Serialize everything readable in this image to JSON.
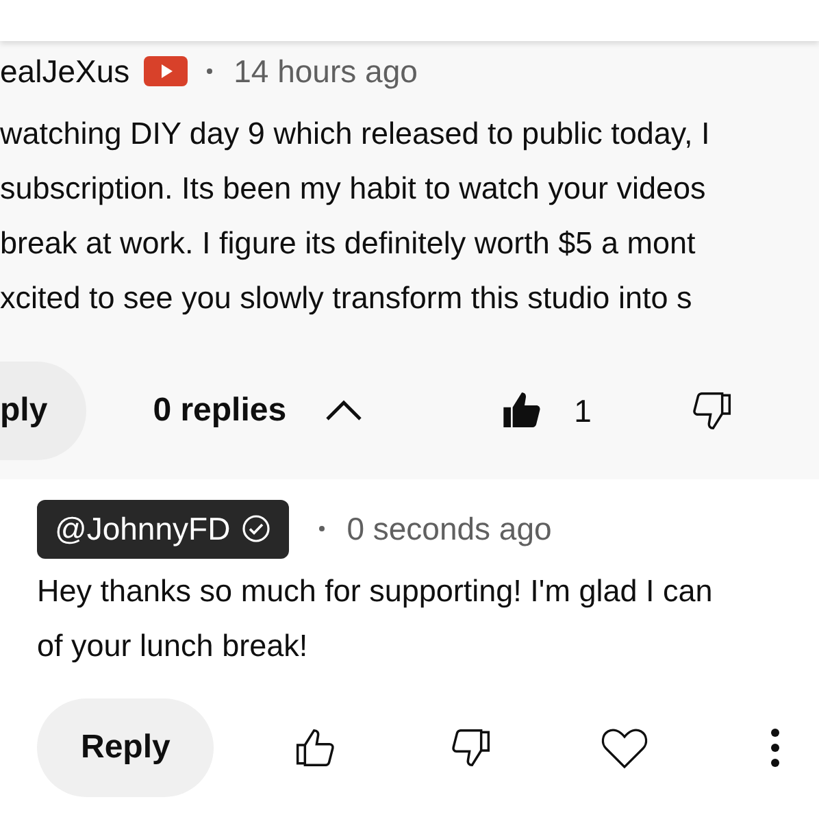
{
  "comment": {
    "author": "ealJeXus",
    "time": "14 hours ago",
    "lines": [
      "watching DIY day 9 which released to public today, I",
      "subscription. Its been my habit to watch your videos",
      "break at work. I figure its definitely worth $5 a mont",
      "xcited to see you slowly transform this studio into s"
    ],
    "reply_button": "ply",
    "replies_toggle": "0 replies",
    "expanded": true,
    "liked": true,
    "like_count": "1"
  },
  "reply": {
    "author": "@JohnnyFD",
    "verified": true,
    "time": "0 seconds ago",
    "lines": [
      "Hey thanks so much for supporting! I'm glad I can",
      "of your lunch break!"
    ],
    "reply_button": "Reply",
    "liked": false,
    "hearted": false
  }
}
